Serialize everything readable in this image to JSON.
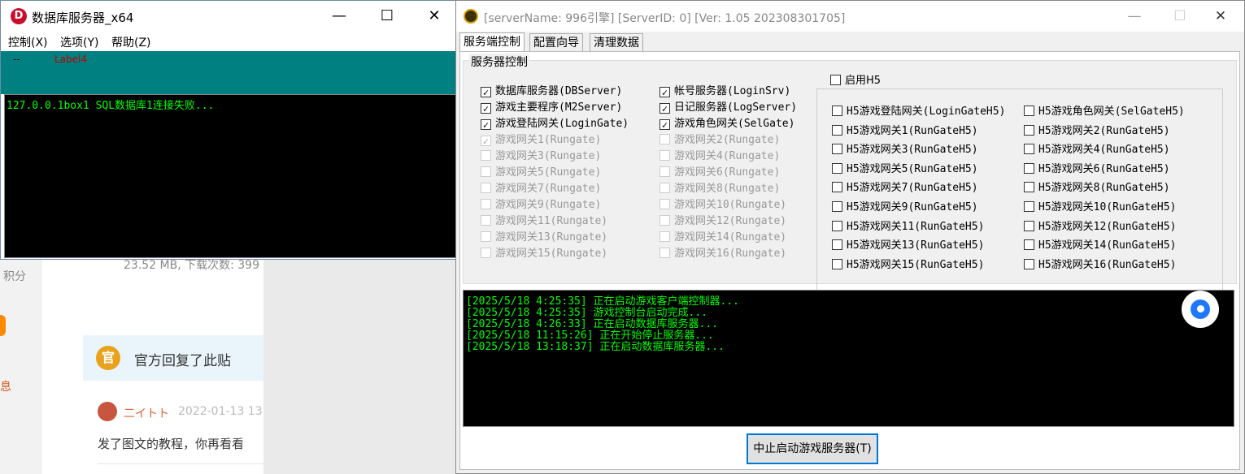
{
  "background": {
    "size_info": "23.52 MB, 下载次数: 399",
    "points": "积分",
    "message": "息",
    "reply_text": "官方回复了此贴",
    "reply_badge": "官",
    "username": "二イトト",
    "date": "2022-01-13 13",
    "post_text": "发了图文的教程，你再看看"
  },
  "win1": {
    "title": "数据库服务器_x64",
    "icon_letter": "D",
    "controls": {
      "minimize": "—",
      "maximize": "☐",
      "close": "✕"
    },
    "menu": [
      "控制(X)",
      "选项(Y)",
      "帮助(Z)"
    ],
    "status_dash": "--",
    "status_label": "Label4",
    "console": "127.0.0.1box1 SQL数据库1连接失败..."
  },
  "win2": {
    "title": "[serverName: 996引擎] [ServerID: 0] [Ver:  1.05 202308301705]",
    "controls": {
      "minimize": "—",
      "maximize": "☐",
      "close": "✕"
    },
    "tabs": [
      "服务端控制",
      "配置向导",
      "清理数据"
    ],
    "group_title": "服务器控制",
    "col1": [
      {
        "label": "数据库服务器(DBServer)",
        "checked": true,
        "enabled": true
      },
      {
        "label": "游戏主要程序(M2Server)",
        "checked": true,
        "enabled": true
      },
      {
        "label": "游戏登陆网关(LoginGate)",
        "checked": true,
        "enabled": true
      },
      {
        "label": "游戏网关1(Rungate)",
        "checked": true,
        "enabled": false
      },
      {
        "label": "游戏网关3(Rungate)",
        "checked": false,
        "enabled": false
      },
      {
        "label": "游戏网关5(Rungate)",
        "checked": false,
        "enabled": false
      },
      {
        "label": "游戏网关7(Rungate)",
        "checked": false,
        "enabled": false
      },
      {
        "label": "游戏网关9(Rungate)",
        "checked": false,
        "enabled": false
      },
      {
        "label": "游戏网关11(Rungate)",
        "checked": false,
        "enabled": false
      },
      {
        "label": "游戏网关13(Rungate)",
        "checked": false,
        "enabled": false
      },
      {
        "label": "游戏网关15(Rungate)",
        "checked": false,
        "enabled": false
      }
    ],
    "col2": [
      {
        "label": "帐号服务器(LoginSrv)",
        "checked": true,
        "enabled": true
      },
      {
        "label": "日记服务器(LogServer)",
        "checked": true,
        "enabled": true
      },
      {
        "label": "游戏角色网关(SelGate)",
        "checked": true,
        "enabled": true
      },
      {
        "label": "游戏网关2(Rungate)",
        "checked": false,
        "enabled": false
      },
      {
        "label": "游戏网关4(Rungate)",
        "checked": false,
        "enabled": false
      },
      {
        "label": "游戏网关6(Rungate)",
        "checked": false,
        "enabled": false
      },
      {
        "label": "游戏网关8(Rungate)",
        "checked": false,
        "enabled": false
      },
      {
        "label": "游戏网关10(Rungate)",
        "checked": false,
        "enabled": false
      },
      {
        "label": "游戏网关12(Rungate)",
        "checked": false,
        "enabled": false
      },
      {
        "label": "游戏网关14(Rungate)",
        "checked": false,
        "enabled": false
      },
      {
        "label": "游戏网关16(Rungate)",
        "checked": false,
        "enabled": false
      }
    ],
    "h5_enable": {
      "label": "启用H5",
      "checked": false
    },
    "h5_col1": [
      "H5游戏登陆网关(LoginGateH5)",
      "H5游戏网关1(RunGateH5)",
      "H5游戏网关3(RunGateH5)",
      "H5游戏网关5(RunGateH5)",
      "H5游戏网关7(RunGateH5)",
      "H5游戏网关9(RunGateH5)",
      "H5游戏网关11(RunGateH5)",
      "H5游戏网关13(RunGateH5)",
      "H5游戏网关15(RunGateH5)"
    ],
    "h5_col2": [
      "H5游戏角色网关(SelGateH5)",
      "H5游戏网关2(RunGateH5)",
      "H5游戏网关4(RunGateH5)",
      "H5游戏网关6(RunGateH5)",
      "H5游戏网关8(RunGateH5)",
      "H5游戏网关10(RunGateH5)",
      "H5游戏网关12(RunGateH5)",
      "H5游戏网关14(RunGateH5)",
      "H5游戏网关16(RunGateH5)"
    ],
    "logs": [
      "[2025/5/18 4:25:35] 正在启动游戏客户端控制器...",
      "[2025/5/18 4:25:35] 游戏控制台启动完成...",
      "[2025/5/18 4:26:33] 正在启动数据库服务器...",
      "[2025/5/18 11:15:26] 正在开始停止服务器...",
      "[2025/5/18 13:18:37] 正在启动数据库服务器..."
    ],
    "stop_button": "中止启动游戏服务器(T)"
  }
}
